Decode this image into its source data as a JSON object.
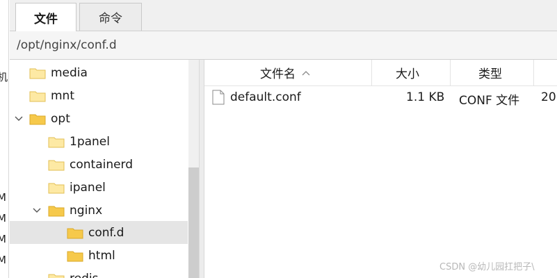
{
  "tabs": [
    {
      "label": "文件",
      "active": true
    },
    {
      "label": "命令",
      "active": false
    }
  ],
  "path": {
    "value": "/opt/nginx/conf.d"
  },
  "tree": {
    "items": [
      {
        "label": "media",
        "expanded": null,
        "selected": false
      },
      {
        "label": "mnt",
        "expanded": null,
        "selected": false
      },
      {
        "label": "opt",
        "expanded": true,
        "selected": false
      },
      {
        "label": "1panel",
        "expanded": null,
        "selected": false
      },
      {
        "label": "containerd",
        "expanded": null,
        "selected": false
      },
      {
        "label": "ipanel",
        "expanded": null,
        "selected": false
      },
      {
        "label": "nginx",
        "expanded": true,
        "selected": false
      },
      {
        "label": "conf.d",
        "expanded": null,
        "selected": true
      },
      {
        "label": "html",
        "expanded": null,
        "selected": false
      },
      {
        "label": "redis",
        "expanded": null,
        "selected": false
      }
    ]
  },
  "files": {
    "columns": {
      "name": "文件名",
      "size": "大小",
      "type": "类型",
      "date": ""
    },
    "rows": [
      {
        "name": "default.conf",
        "size": "1.1 KB",
        "type": "CONF 文件",
        "date": "20"
      }
    ]
  },
  "watermark": "CSDN @幼儿园扛把子\\",
  "left_strip": {
    "chars": [
      "机",
      "M",
      "M",
      "M",
      "M"
    ]
  },
  "colors": {
    "folder": "#f6c94b",
    "folder_light": "#fde9a4",
    "selected_row": "#e5e5e5"
  }
}
